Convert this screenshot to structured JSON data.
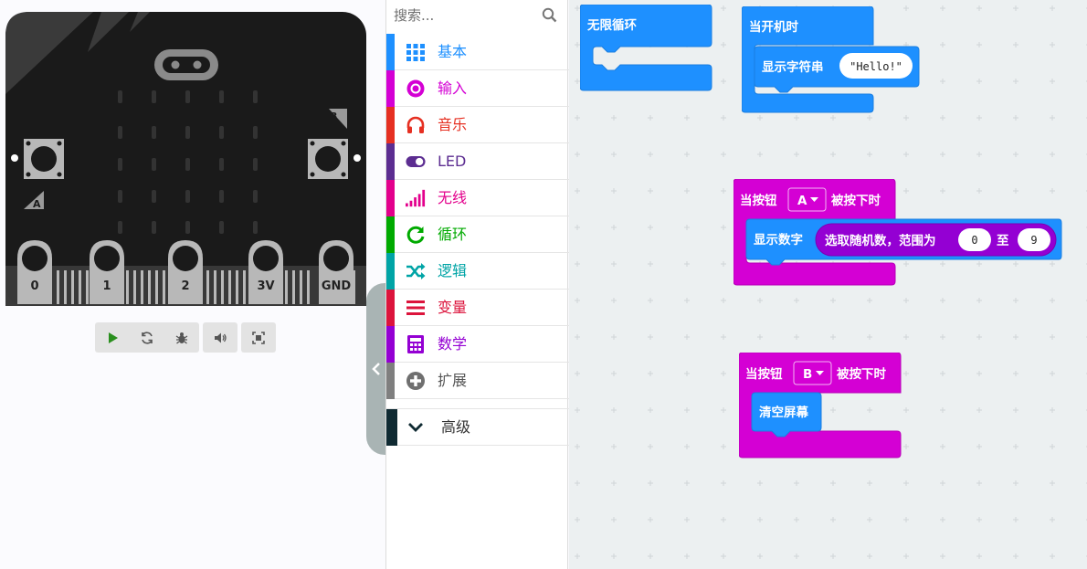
{
  "simulator": {
    "pins": [
      "0",
      "1",
      "2",
      "3V",
      "GND"
    ],
    "button_a": "A",
    "button_b": "B",
    "controls": [
      "play-icon",
      "restart-icon",
      "debug-icon",
      "sound-icon",
      "fullscreen-icon"
    ]
  },
  "search": {
    "placeholder": "搜索..."
  },
  "categories": [
    {
      "label": "基本",
      "color": "#1e90ff",
      "icon": "grid-icon"
    },
    {
      "label": "输入",
      "color": "#d400d4",
      "icon": "radio-icon"
    },
    {
      "label": "音乐",
      "color": "#e63022",
      "icon": "headphones-icon"
    },
    {
      "label": "LED",
      "color": "#5c2d91",
      "icon": "toggle-icon"
    },
    {
      "label": "无线",
      "color": "#e3008c",
      "icon": "signal-icon"
    },
    {
      "label": "循环",
      "color": "#00aa00",
      "icon": "refresh-icon"
    },
    {
      "label": "逻辑",
      "color": "#00a4a6",
      "icon": "shuffle-icon"
    },
    {
      "label": "变量",
      "color": "#dc143c",
      "icon": "list-icon"
    },
    {
      "label": "数学",
      "color": "#9400d3",
      "icon": "calculator-icon"
    },
    {
      "label": "扩展",
      "color": "#7f7f7f",
      "icon": "plus-circle-icon"
    }
  ],
  "advanced": {
    "label": "高级",
    "color": "#0f2a32"
  },
  "blocks": {
    "forever": {
      "label": "无限循环",
      "color": "#1e90ff"
    },
    "on_start": {
      "label": "当开机时",
      "color": "#1e90ff",
      "inner_label": "显示字符串",
      "string_value": "\"Hello!\""
    },
    "button_a": {
      "label_pre": "当按钮",
      "dropdown": "A",
      "label_post": "被按下时",
      "color": "#d400d4",
      "inner_label": "显示数字",
      "random_label": "选取随机数，范围为",
      "from": "0",
      "to_label": "至",
      "to": "9",
      "inner_color": "#1e90ff",
      "random_color": "#9400d3"
    },
    "button_b": {
      "label_pre": "当按钮",
      "dropdown": "B",
      "label_post": "被按下时",
      "color": "#d400d4",
      "inner_label": "清空屏幕",
      "inner_color": "#1e90ff"
    }
  }
}
